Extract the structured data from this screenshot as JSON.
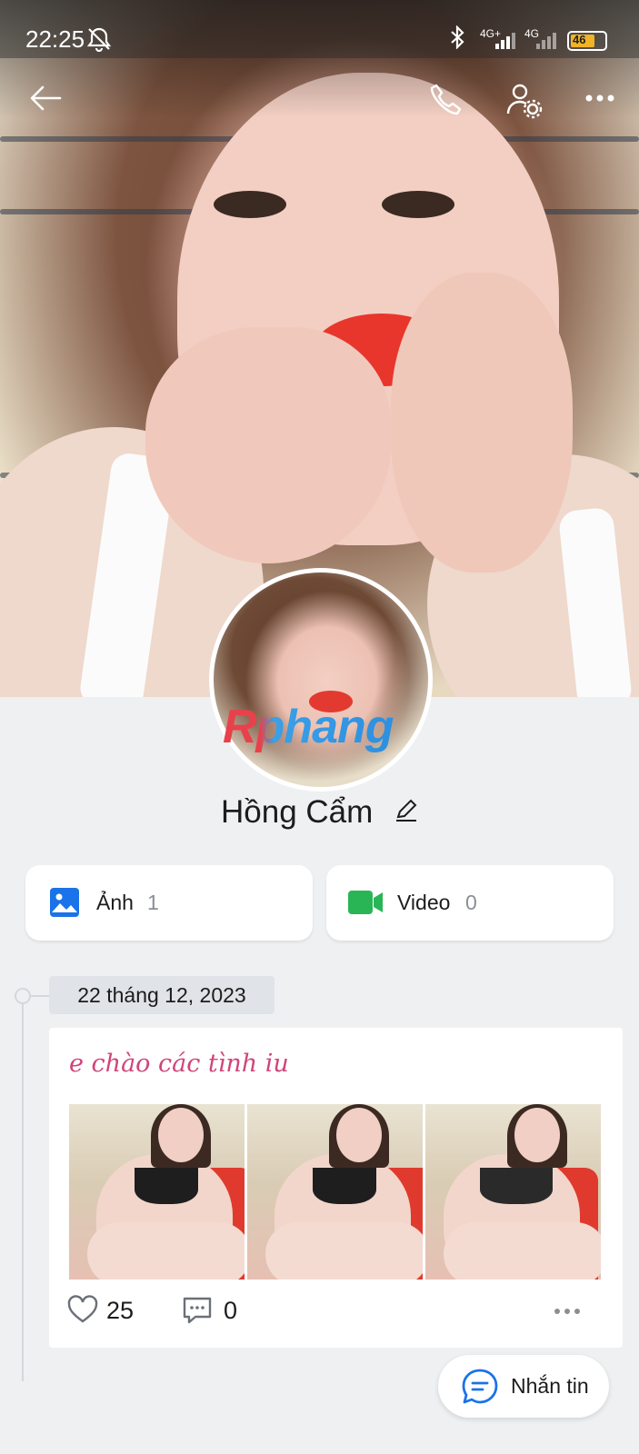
{
  "status_bar": {
    "time": "22:25",
    "network_1": "4G+",
    "network_2": "4G",
    "battery": "46"
  },
  "header": {
    "icons": [
      "back-arrow-icon",
      "phone-icon",
      "user-settings-icon",
      "more-icon"
    ]
  },
  "profile": {
    "name": "Hồng Cẩm",
    "watermark": "Rphang"
  },
  "media": {
    "photos_label": "Ảnh",
    "photos_count": "1",
    "videos_label": "Video",
    "videos_count": "0"
  },
  "timeline": {
    "date": "22 tháng 12, 2023",
    "post": {
      "caption": "e chào các tình iu",
      "photo_count": 3,
      "likes": "25",
      "comments": "0"
    }
  },
  "actions": {
    "chat_label": "Nhắn tin"
  },
  "colors": {
    "accent_blue": "#1a73e8",
    "video_green": "#29b556",
    "caption_pink": "#d0457a",
    "battery_yellow": "#f0b32a"
  }
}
